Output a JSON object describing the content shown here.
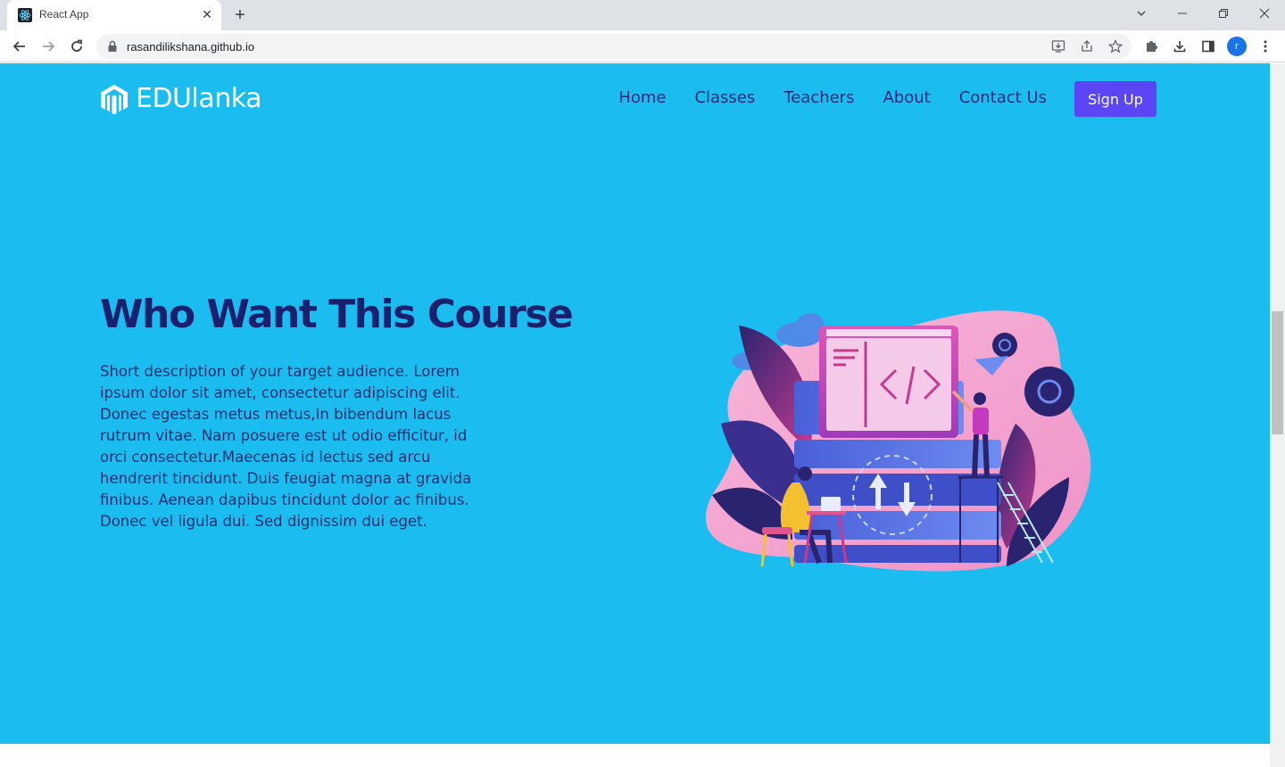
{
  "browser": {
    "tab_title": "React App",
    "url": "rasandilikshana.github.io",
    "profile_initial": "r"
  },
  "nav": {
    "brand": "EDUlanka",
    "links": [
      "Home",
      "Classes",
      "Teachers",
      "About",
      "Contact Us"
    ],
    "signup_label": "Sign Up"
  },
  "hero": {
    "title": "Who Want This Course",
    "description": "Short description of your target audience. Lorem ipsum dolor sit amet, consectetur adipiscing elit. Donec egestas metus metus,In bibendum lacus rutrum vitae. Nam posuere est ut odio efficitur, id orci consectetur.Maecenas id lectus sed arcu hendrerit tincidunt. Duis feugiat magna at gravida finibus. Aenean dapibus tincidunt dolor ac finibus. Donec vel ligula dui. Sed dignissim dui eget.",
    "background_color": "#1bbcf0",
    "title_color": "#1a1f6e",
    "button_color": "#5b45f5"
  },
  "icons": [
    "react-favicon",
    "close-icon",
    "plus-icon",
    "back-arrow-icon",
    "forward-arrow-icon",
    "reload-icon",
    "lock-icon",
    "install-icon",
    "share-icon",
    "star-icon",
    "puzzle-icon",
    "download-icon",
    "sidepanel-icon",
    "kebab-menu-icon",
    "edu-logo-icon"
  ]
}
